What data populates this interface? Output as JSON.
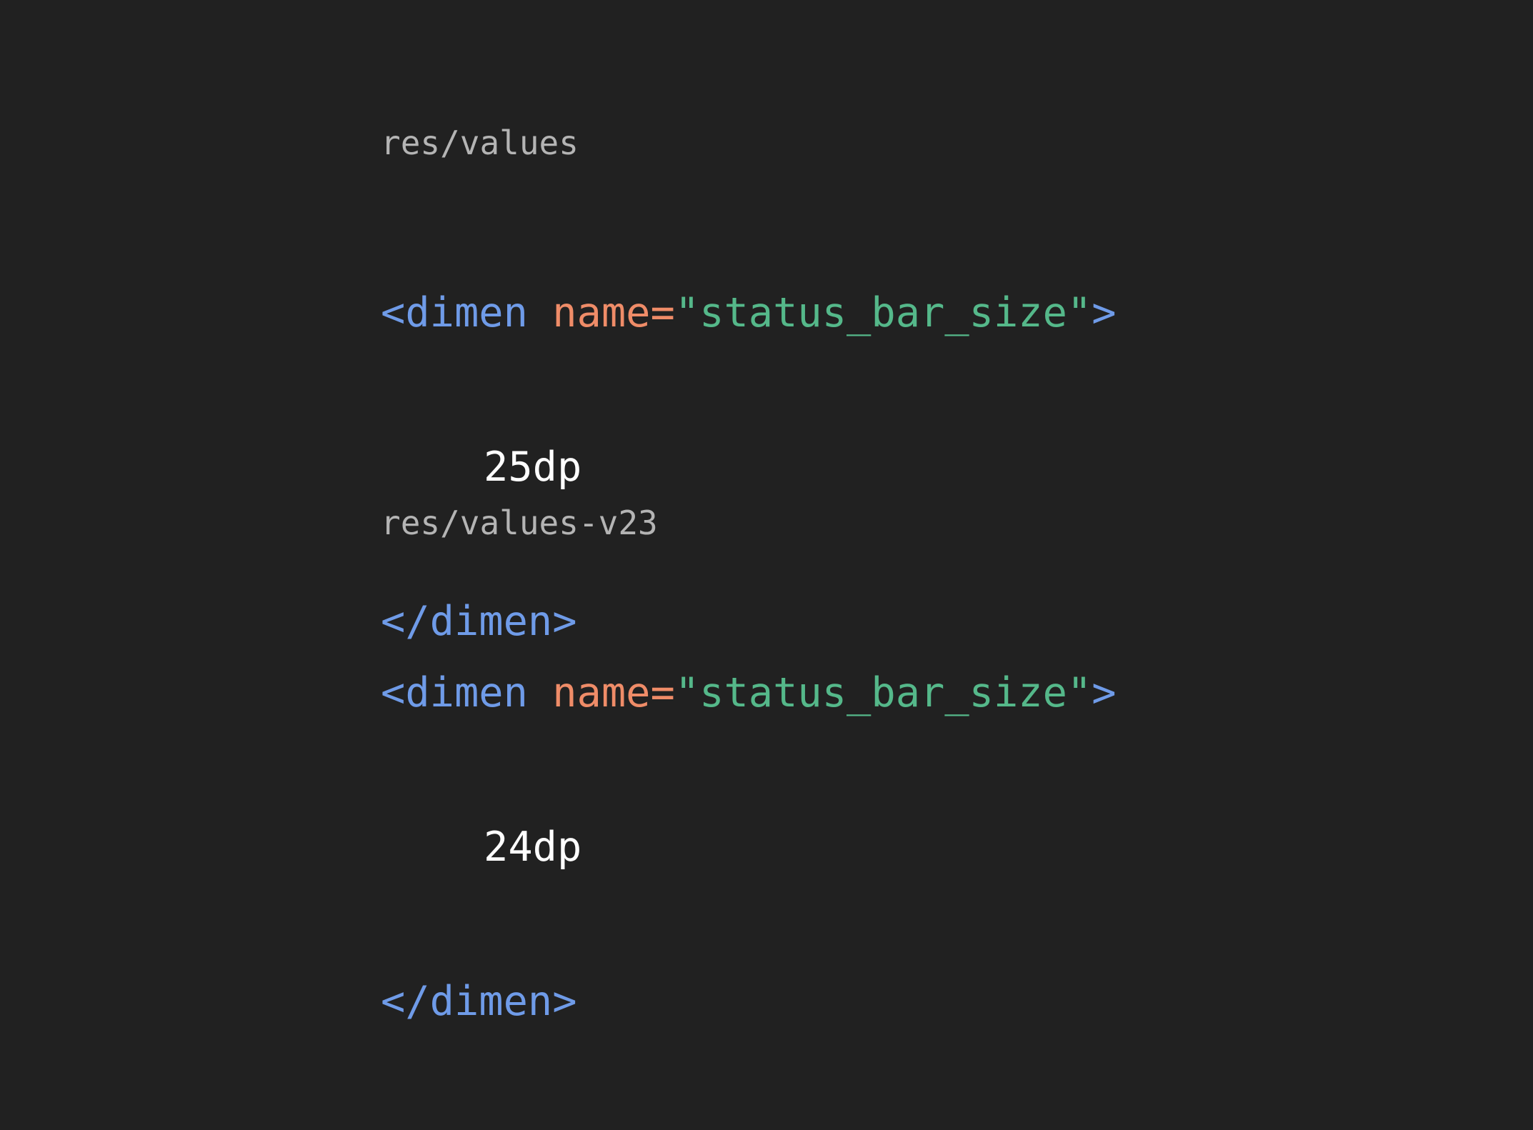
{
  "colors": {
    "background": "#212121",
    "path_label": "#b4b4b4",
    "tag": "#6f9be8",
    "attribute": "#ef8c68",
    "string": "#55b88a",
    "value": "#ffffff"
  },
  "snippets": [
    {
      "path": "res/values",
      "open_tag": "<dimen",
      "attr_name": "name",
      "equals": "=",
      "attr_value": "\"status_bar_size\"",
      "open_tag_end": ">",
      "value": "25dp",
      "close_tag": "</dimen>"
    },
    {
      "path": "res/values-v23",
      "open_tag": "<dimen",
      "attr_name": "name",
      "equals": "=",
      "attr_value": "\"status_bar_size\"",
      "open_tag_end": ">",
      "value": "24dp",
      "close_tag": "</dimen>"
    }
  ]
}
